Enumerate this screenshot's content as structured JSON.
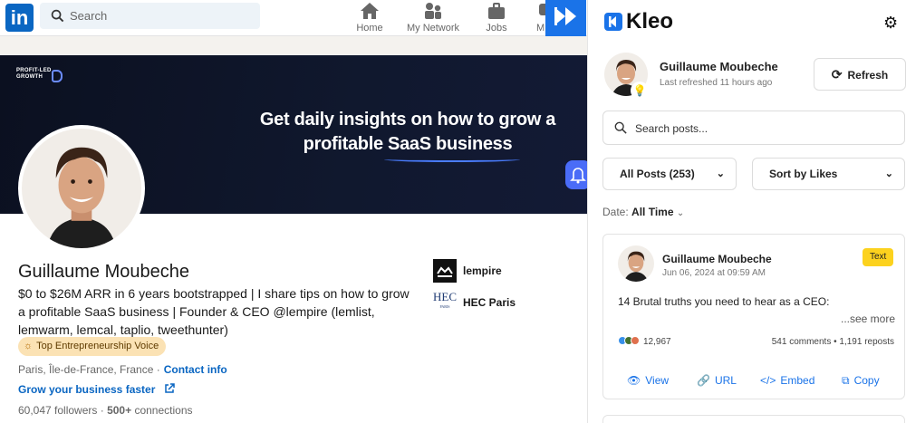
{
  "linkedin": {
    "search_placeholder": "Search",
    "nav": [
      {
        "label": "Home",
        "icon": "home-icon"
      },
      {
        "label": "My Network",
        "icon": "network-icon"
      },
      {
        "label": "Jobs",
        "icon": "briefcase-icon"
      },
      {
        "label": "M",
        "icon": "messaging-icon"
      }
    ]
  },
  "banner": {
    "brand": "PROFIT-LED GROWTH",
    "headline_line1": "Get daily insights on how to grow a",
    "headline_line2": "profitable SaaS business"
  },
  "profile": {
    "name": "Guillaume Moubeche",
    "headline": "$0 to $26M ARR in 6 years bootstrapped | I share tips on how to grow a profitable SaaS business | Founder & CEO @lempire (lemlist, lemwarm, lemcal, taplio, tweethunter)",
    "badge": "Top Entrepreneurship Voice",
    "location": "Paris, Île-de-France, France ·",
    "contact_link": "Contact info",
    "website_link": "Grow your business faster",
    "followers": "60,047",
    "followers_label": "followers",
    "connections": "500+",
    "connections_label": "connections",
    "orgs": [
      {
        "name": "lempire",
        "icon": "lempire-logo"
      },
      {
        "name": "HEC Paris",
        "icon": "hec-logo",
        "logo_text": "HEC",
        "logo_subtext": "PARIS"
      }
    ]
  },
  "kleo": {
    "title": "Kleo",
    "user_name": "Guillaume Moubeche",
    "last_refreshed": "Last refreshed 11 hours ago",
    "refresh_label": "Refresh",
    "search_placeholder": "Search posts...",
    "filter_posts": "All Posts (253)",
    "sort_by": "Sort by Likes",
    "date_label": "Date:",
    "date_value": "All Time",
    "post": {
      "author": "Guillaume Moubeche",
      "date": "Jun 06, 2024 at 09:59 AM",
      "type_tag": "Text",
      "text": "14 Brutal truths you need to hear as a CEO:",
      "see_more": "...see more",
      "reactions": "12,967",
      "stats": "541 comments • 1,191 reposts",
      "actions": {
        "view": "View",
        "url": "URL",
        "embed": "Embed",
        "copy": "Copy"
      }
    }
  },
  "colors": {
    "linkedin_blue": "#0a66c2",
    "kleo_blue": "#1a73e8",
    "tag_yellow": "#fcd21e",
    "banner_dark": "#0b1020"
  }
}
